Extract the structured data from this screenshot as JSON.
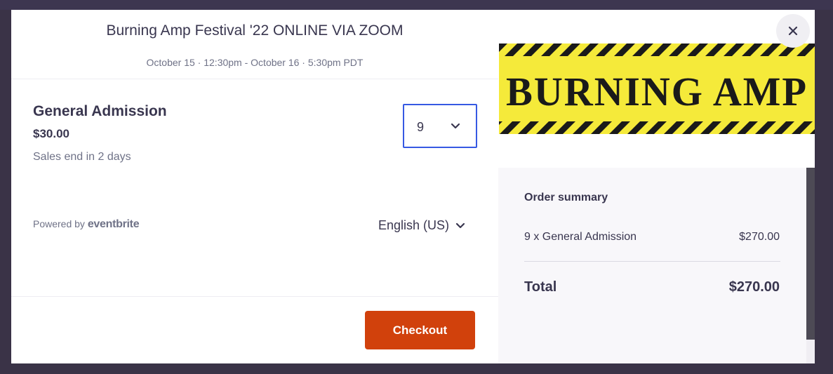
{
  "event": {
    "title": "Burning Amp Festival '22 ONLINE VIA ZOOM",
    "date_range": "October 15 · 12:30pm - October 16 · 5:30pm PDT"
  },
  "ticket": {
    "name": "General Admission",
    "price": "$30.00",
    "sales_status": "Sales end in 2 days",
    "quantity_selected": "9"
  },
  "footer": {
    "powered_by_prefix": "Powered by",
    "brand": "eventbrite",
    "language": "English (US)",
    "checkout_label": "Checkout"
  },
  "banner": {
    "text": "BURNING AMP",
    "colors": {
      "stripe_yellow": "#f5ea3a",
      "stripe_black": "#1a1a1a",
      "text": "#1a1a1a"
    }
  },
  "order_summary": {
    "title": "Order summary",
    "line_item_label": "9 x General Admission",
    "line_item_price": "$270.00",
    "total_label": "Total",
    "total_value": "$270.00"
  },
  "icons": {
    "close": "close-icon",
    "quantity_chevron": "chevron-down-icon",
    "language_chevron": "chevron-down-icon"
  },
  "colors": {
    "accent": "#d1410c",
    "focus_border": "#3659e3",
    "text_primary": "#39364f",
    "text_secondary": "#6f7287"
  }
}
